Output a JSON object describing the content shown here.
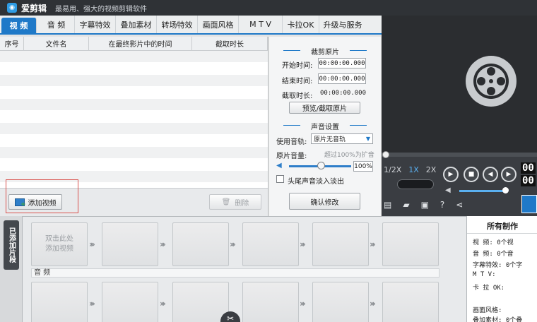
{
  "app": {
    "name": "爱剪辑",
    "slogan": "最易用、强大的视频剪辑软件"
  },
  "tabs": [
    "视 频",
    "音 频",
    "字幕特效",
    "叠加素材",
    "转场特效",
    "画面风格",
    "M T V",
    "卡拉OK",
    "升级与服务"
  ],
  "clip_list": {
    "columns": [
      "序号",
      "文件名",
      "在最终影片中的时间",
      "截取时长"
    ],
    "add_button": "添加视频",
    "delete_button": "删除"
  },
  "trim": {
    "title": "裁剪原片",
    "start_label": "开始时间:",
    "start_value": "00:00:00.000",
    "end_label": "结束时间:",
    "end_value": "00:00:00.000",
    "duration_label": "截取时长:",
    "duration_value": "00:00:00.000",
    "preview_button": "预览/截取原片"
  },
  "audio": {
    "title": "声音设置",
    "track_label": "使用音轨:",
    "track_value": "原片无音轨",
    "volume_label": "原片音量:",
    "volume_hint": "超过100%为扩音",
    "volume_value": "100%",
    "fade_label": "头尾声音淡入淡出",
    "confirm_button": "确认修改"
  },
  "player": {
    "speeds": [
      "1/2X",
      "1X",
      "2X"
    ],
    "time_top": "00",
    "time_bottom": "00",
    "volume_level": 0.8
  },
  "timeline": {
    "added_label": "已添加片段",
    "first_clip_line1": "双击此处",
    "first_clip_line2": "添加视频",
    "audio_label": "音 频"
  },
  "stats": {
    "title": "所有制作",
    "lines": [
      "视    频: 0个视",
      "音    频: 0个音",
      "字幕特效: 0个字",
      "M T V:",
      "卡 拉 OK:",
      "画面风格:",
      "叠加素材: 0个叠"
    ]
  },
  "colors": {
    "accent": "#1f79c8",
    "dark": "#2f3236"
  }
}
